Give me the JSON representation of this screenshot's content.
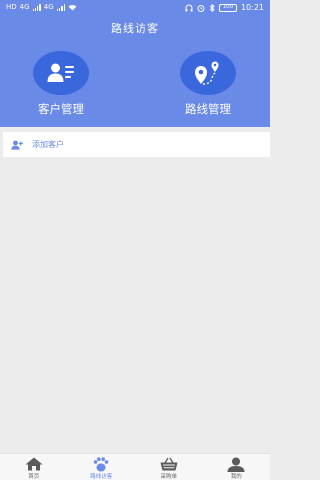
{
  "status_bar": {
    "network_left": "HD",
    "signal_1": "4G",
    "signal_2": "4G",
    "battery": "100",
    "time": "10:21"
  },
  "header": {
    "title": "路线访客"
  },
  "tiles": [
    {
      "label": "客户管理",
      "icon": "customer-list-icon"
    },
    {
      "label": "路线管理",
      "icon": "route-map-icon"
    }
  ],
  "add_customer": {
    "label": "添加客户",
    "icon": "add-user-icon"
  },
  "tabbar": {
    "items": [
      {
        "label": "首页",
        "icon": "home-icon",
        "active": false
      },
      {
        "label": "路线访客",
        "icon": "footprint-icon",
        "active": true
      },
      {
        "label": "采购单",
        "icon": "basket-icon",
        "active": false
      },
      {
        "label": "我的",
        "icon": "person-icon",
        "active": false
      }
    ]
  },
  "colors": {
    "header_bg": "#6a8ae8",
    "tile_circle": "#3b67dd",
    "accent_text": "#6a8ae8",
    "page_bg": "#ececec"
  }
}
